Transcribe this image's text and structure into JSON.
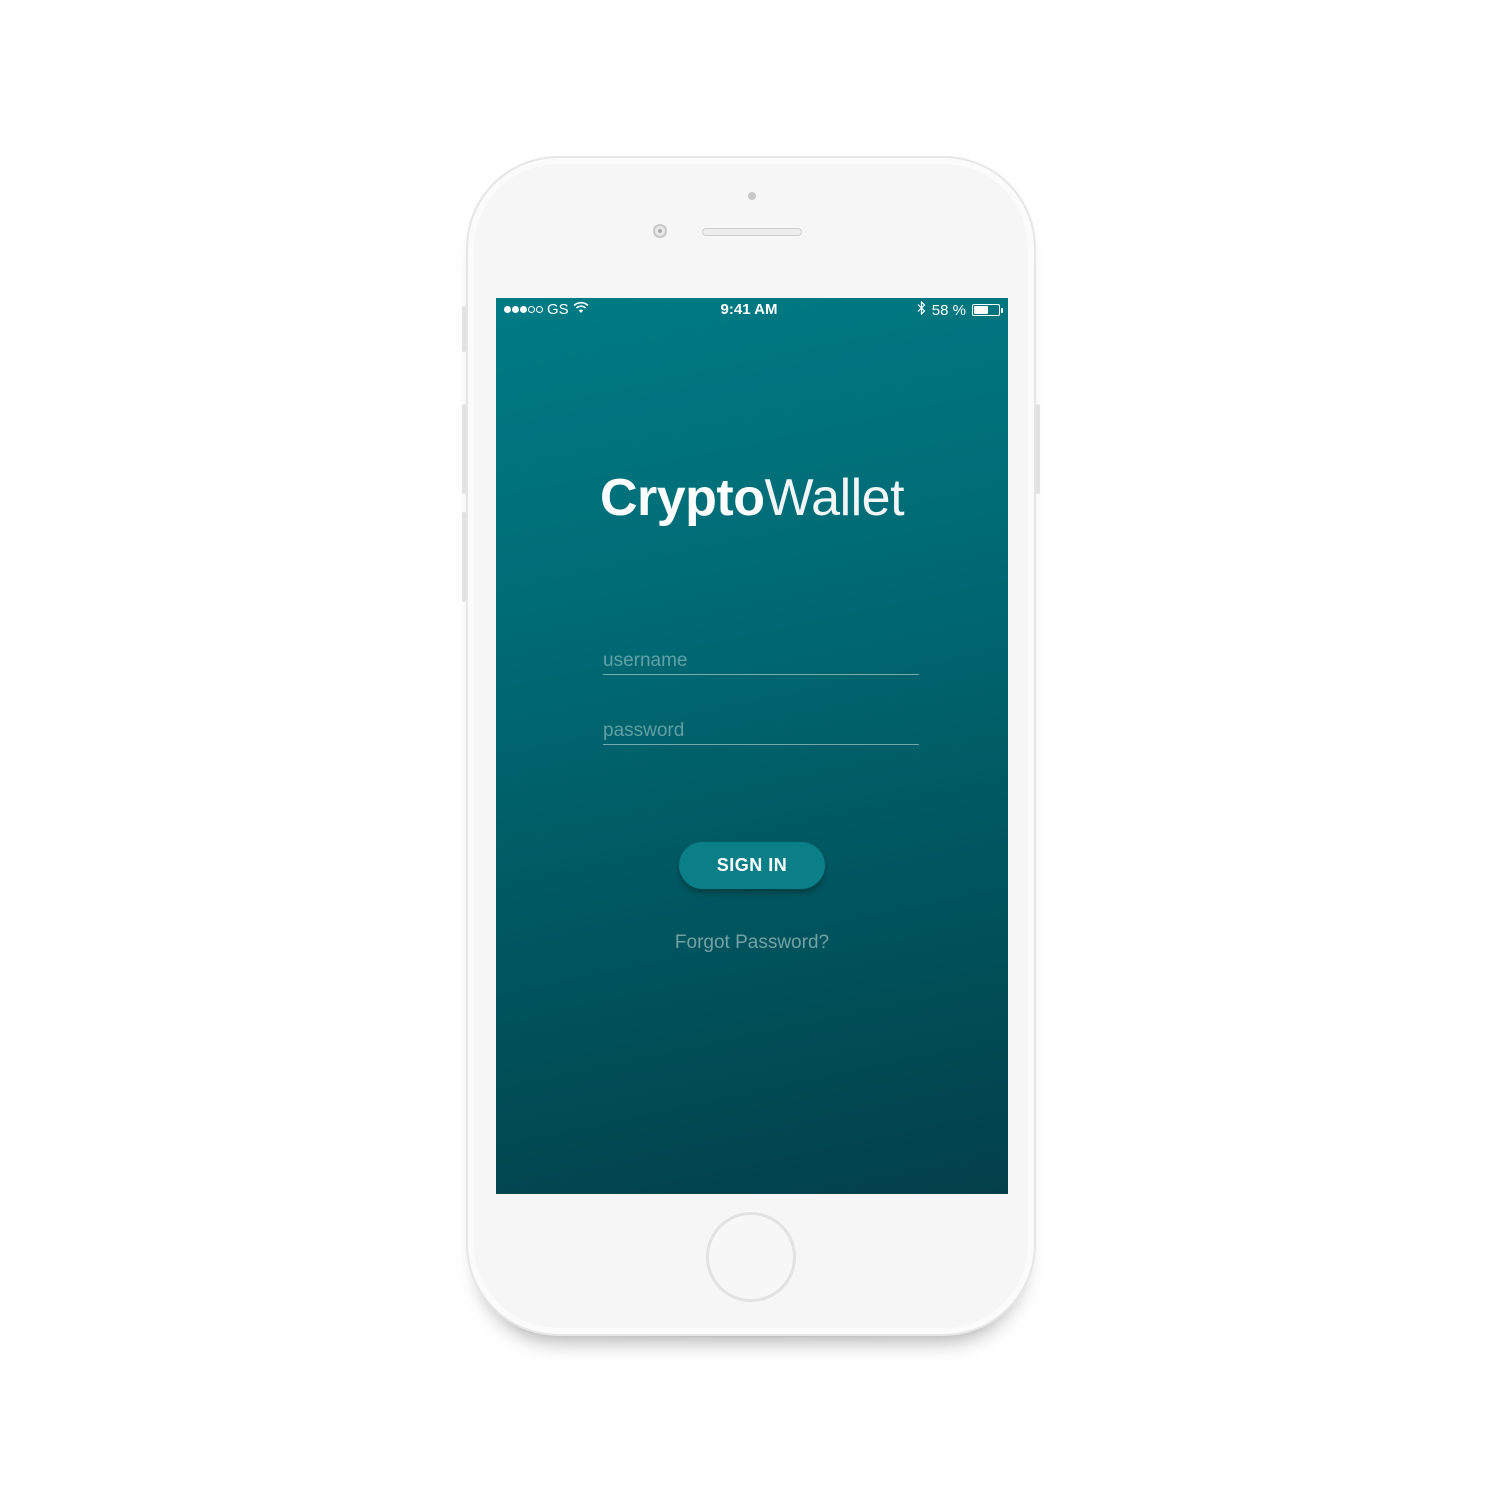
{
  "status_bar": {
    "carrier": "GS",
    "signal_bars_filled": 3,
    "signal_bars_total": 5,
    "wifi_icon": "wifi-icon",
    "time": "9:41 AM",
    "bluetooth_icon": "bluetooth-icon",
    "battery_percent_label": "58 %",
    "battery_level": 0.58
  },
  "app": {
    "logo_bold": "Crypto",
    "logo_light": "Wallet"
  },
  "login": {
    "username_placeholder": "username",
    "password_placeholder": "password",
    "sign_in_label": "SIGN IN",
    "forgot_password_label": "Forgot Password?"
  },
  "colors": {
    "gradient_top": "#007b84",
    "gradient_bottom": "#03404a",
    "button": "#0a7f88"
  }
}
